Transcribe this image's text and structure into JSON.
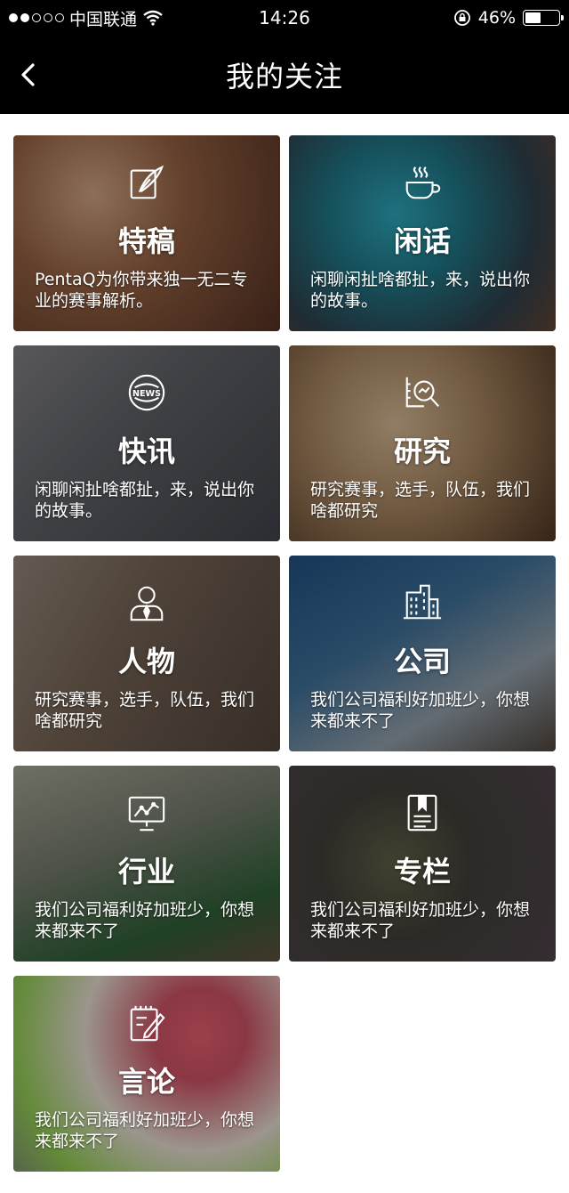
{
  "status_bar": {
    "carrier": "中国联通",
    "time": "14:26",
    "battery_text": "46%",
    "battery_level": 0.46
  },
  "nav": {
    "title": "我的关注"
  },
  "cards": [
    {
      "title": "特稿",
      "desc": "PentaQ为你带来独一无二专业的赛事解析。",
      "icon": "quill-icon"
    },
    {
      "title": "闲话",
      "desc": "闲聊闲扯啥都扯，来，说出你的故事。",
      "icon": "coffee-cup-icon"
    },
    {
      "title": "快讯",
      "desc": "闲聊闲扯啥都扯，来，说出你的故事。",
      "icon": "news-icon"
    },
    {
      "title": "研究",
      "desc": "研究赛事，选手，队伍，我们啥都研究",
      "icon": "magnifier-chart-icon"
    },
    {
      "title": "人物",
      "desc": "研究赛事，选手，队伍，我们啥都研究",
      "icon": "person-icon"
    },
    {
      "title": "公司",
      "desc": "我们公司福利好加班少，你想来都来不了",
      "icon": "building-icon"
    },
    {
      "title": "行业",
      "desc": "我们公司福利好加班少，你想来都来不了",
      "icon": "presentation-chart-icon"
    },
    {
      "title": "专栏",
      "desc": "我们公司福利好加班少，你想来都来不了",
      "icon": "bookmark-document-icon"
    },
    {
      "title": "言论",
      "desc": "我们公司福利好加班少，你想来都来不了",
      "icon": "notepad-pen-icon"
    }
  ]
}
